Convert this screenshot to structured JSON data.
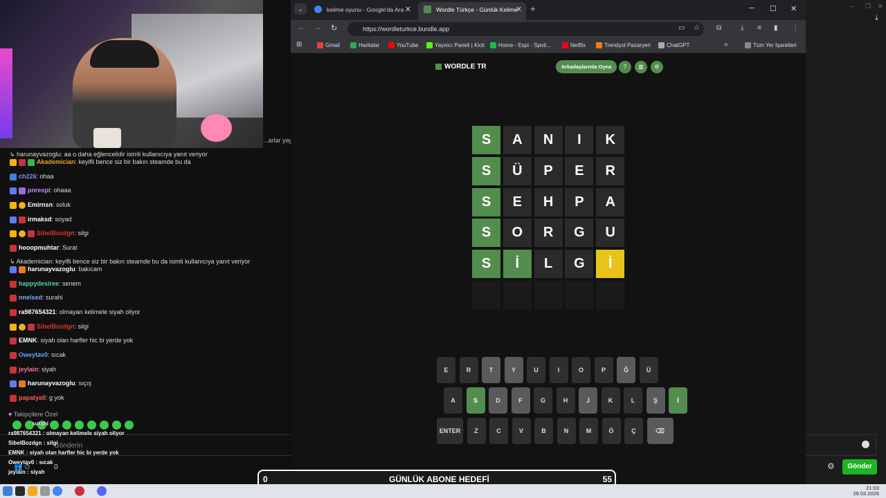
{
  "stream": {
    "cam_side_text": "...arlar yayı",
    "reply_1": "↳ harunayvazoglu: aa o daha eğlencelidir isimli kullanıcıya yanıt veriyor",
    "reply_2": "↳ Akademician: keyifli bence siz bir bakın steamde bu da isimli kullanıcıya yanıt veriyor",
    "followers_label": "♥ Takipçilere Özel",
    "input_placeholder": "Gönderin",
    "viewer_count": "0",
    "send_label": "Gönder",
    "messages": [
      {
        "user": "Akademician",
        "text": ": keyifli bence siz bir bakın steamde bu da",
        "color": "#e7a316"
      },
      {
        "user": "ch226",
        "text": ": ohaa",
        "color": "#7f8cff"
      },
      {
        "user": "pnrespi",
        "text": ": ohaaa",
        "color": "#c28cff"
      },
      {
        "user": "Emirnsn",
        "text": ": soluk",
        "color": "#ffffff"
      },
      {
        "user": "irmaksd",
        "text": ": soyad",
        "color": "#ffffff"
      },
      {
        "user": "SibelBozdgn",
        "text": ": silgi",
        "color": "#d83333"
      },
      {
        "user": "hooopmuhtar",
        "text": ": Surat",
        "color": "#ffffff"
      },
      {
        "user": "harunayvazoglu",
        "text": ": bakıcam",
        "color": "#ffffff"
      },
      {
        "user": "happydesiree",
        "text": ": senem",
        "color": "#53d6a0"
      },
      {
        "user": "nnelsed",
        "text": ": surahi",
        "color": "#7fa6ff"
      },
      {
        "user": "ra987654321",
        "text": ": olmayan kelimele siyah oliyor",
        "color": "#ffffff"
      },
      {
        "user": "SibelBozdgn",
        "text": ": silgi",
        "color": "#d83333"
      },
      {
        "user": "EMNK",
        "text": ": siyah olan harfler hic bi yerde yok",
        "color": "#ffffff"
      },
      {
        "user": "Oweytav0",
        "text": ": sıcak",
        "color": "#5aa8ff"
      },
      {
        "user": "jeylain",
        "text": ": siyah",
        "color": "#ff6b9b"
      },
      {
        "user": "harunayvazoglu",
        "text": ": sıçış",
        "color": "#ffffff"
      },
      {
        "user": "papatya0",
        "text": ": g yok",
        "color": "#ff5b5b"
      }
    ],
    "overlay": [
      "surahi",
      "ra987654321 : olmayan kelimele siyah oliyor",
      "SibelBozdgn : silgi",
      "EMNK : siyah olan harfler hic bi yerde yok",
      "Oweytav0 : sıcak",
      "jeylain : siyah"
    ]
  },
  "browser": {
    "tabs": [
      {
        "label": "kelime oyunu - Google'da Ara",
        "active": false
      },
      {
        "label": "Wordle Türkçe - Günlük Kelime",
        "active": true
      }
    ],
    "url": "https://wordleturkce.bundle.app",
    "bookmarks": [
      {
        "label": "Gmail",
        "color": "#ea4335"
      },
      {
        "label": "Haritalar",
        "color": "#34a853"
      },
      {
        "label": "YouTube",
        "color": "#ff0000"
      },
      {
        "label": "Yayıncı Paneli | Kick",
        "color": "#53fc18"
      },
      {
        "label": "Home - Espi - Spoti...",
        "color": "#1db954"
      },
      {
        "label": "Netflix",
        "color": "#e50914"
      },
      {
        "label": "Trendyol Pazaryeri",
        "color": "#f27a1a"
      },
      {
        "label": "ChatGPT",
        "color": "#aaaaaa"
      }
    ],
    "all_bookmarks": "Tüm Yer İşaretleri"
  },
  "wordle": {
    "logo": "WORDLE TR",
    "play_with_friends": "Arkadaşlarınla Oyna",
    "rows": [
      [
        {
          "l": "S",
          "s": "correct"
        },
        {
          "l": "A",
          "s": "absent"
        },
        {
          "l": "N",
          "s": "absent"
        },
        {
          "l": "I",
          "s": "absent"
        },
        {
          "l": "K",
          "s": "absent"
        }
      ],
      [
        {
          "l": "S",
          "s": "correct"
        },
        {
          "l": "Ü",
          "s": "absent"
        },
        {
          "l": "P",
          "s": "absent"
        },
        {
          "l": "E",
          "s": "absent"
        },
        {
          "l": "R",
          "s": "absent"
        }
      ],
      [
        {
          "l": "S",
          "s": "correct"
        },
        {
          "l": "E",
          "s": "absent"
        },
        {
          "l": "H",
          "s": "absent"
        },
        {
          "l": "P",
          "s": "absent"
        },
        {
          "l": "A",
          "s": "absent"
        }
      ],
      [
        {
          "l": "S",
          "s": "correct"
        },
        {
          "l": "O",
          "s": "absent"
        },
        {
          "l": "R",
          "s": "absent"
        },
        {
          "l": "G",
          "s": "absent"
        },
        {
          "l": "U",
          "s": "absent"
        }
      ],
      [
        {
          "l": "S",
          "s": "correct"
        },
        {
          "l": "İ",
          "s": "correct"
        },
        {
          "l": "L",
          "s": "absent"
        },
        {
          "l": "G",
          "s": "absent"
        },
        {
          "l": "İ",
          "s": "present"
        }
      ],
      [
        {
          "l": "",
          "s": "empty"
        },
        {
          "l": "",
          "s": "empty"
        },
        {
          "l": "",
          "s": "empty"
        },
        {
          "l": "",
          "s": "empty"
        },
        {
          "l": "",
          "s": "empty"
        }
      ]
    ],
    "keyboard": [
      [
        {
          "k": "E",
          "s": "normal"
        },
        {
          "k": "R",
          "s": "normal"
        },
        {
          "k": "T",
          "s": "used"
        },
        {
          "k": "Y",
          "s": "used"
        },
        {
          "k": "U",
          "s": "normal"
        },
        {
          "k": "I",
          "s": "normal"
        },
        {
          "k": "O",
          "s": "normal"
        },
        {
          "k": "P",
          "s": "normal"
        },
        {
          "k": "Ğ",
          "s": "used"
        },
        {
          "k": "Ü",
          "s": "normal"
        }
      ],
      [
        {
          "k": "A",
          "s": "normal"
        },
        {
          "k": "S",
          "s": "green"
        },
        {
          "k": "D",
          "s": "used"
        },
        {
          "k": "F",
          "s": "used"
        },
        {
          "k": "G",
          "s": "normal"
        },
        {
          "k": "H",
          "s": "normal"
        },
        {
          "k": "J",
          "s": "used"
        },
        {
          "k": "K",
          "s": "normal"
        },
        {
          "k": "L",
          "s": "normal"
        },
        {
          "k": "Ş",
          "s": "used"
        },
        {
          "k": "İ",
          "s": "green"
        }
      ],
      [
        {
          "k": "ENTER",
          "s": "normal"
        },
        {
          "k": "Z",
          "s": "normal"
        },
        {
          "k": "C",
          "s": "normal"
        },
        {
          "k": "V",
          "s": "normal"
        },
        {
          "k": "B",
          "s": "normal"
        },
        {
          "k": "N",
          "s": "normal"
        },
        {
          "k": "M",
          "s": "normal"
        },
        {
          "k": "Ö",
          "s": "normal"
        },
        {
          "k": "Ç",
          "s": "normal"
        },
        {
          "k": "⌫",
          "s": "used"
        }
      ]
    ]
  },
  "goal": {
    "left": "0",
    "label": "GÜNLÜK ABONE HEDEFİ",
    "right": "55"
  },
  "taskbar": {
    "time": "21:03",
    "date": "29.03.2026"
  }
}
